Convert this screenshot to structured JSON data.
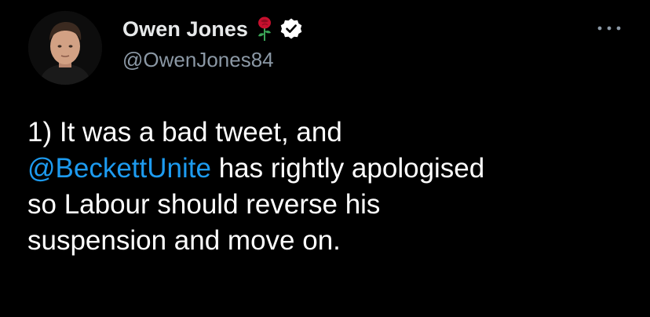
{
  "author": {
    "display_name": "Owen Jones",
    "handle": "@OwenJones84",
    "badges": [
      "rose-icon",
      "verified-icon"
    ],
    "avatar_icon": "avatar"
  },
  "menu": {
    "icon": "more-icon"
  },
  "tweet": {
    "line1": "1) It was a bad tweet, and",
    "mention": "@BeckettUnite",
    "line2_rest": " has rightly apologised",
    "line3": "so Labour should reverse his",
    "line4": "suspension and move on."
  },
  "colors": {
    "background": "#000000",
    "text": "#ffffff",
    "secondary": "#8b98a5",
    "link": "#1d9bf0",
    "rose": "#c8102e"
  }
}
